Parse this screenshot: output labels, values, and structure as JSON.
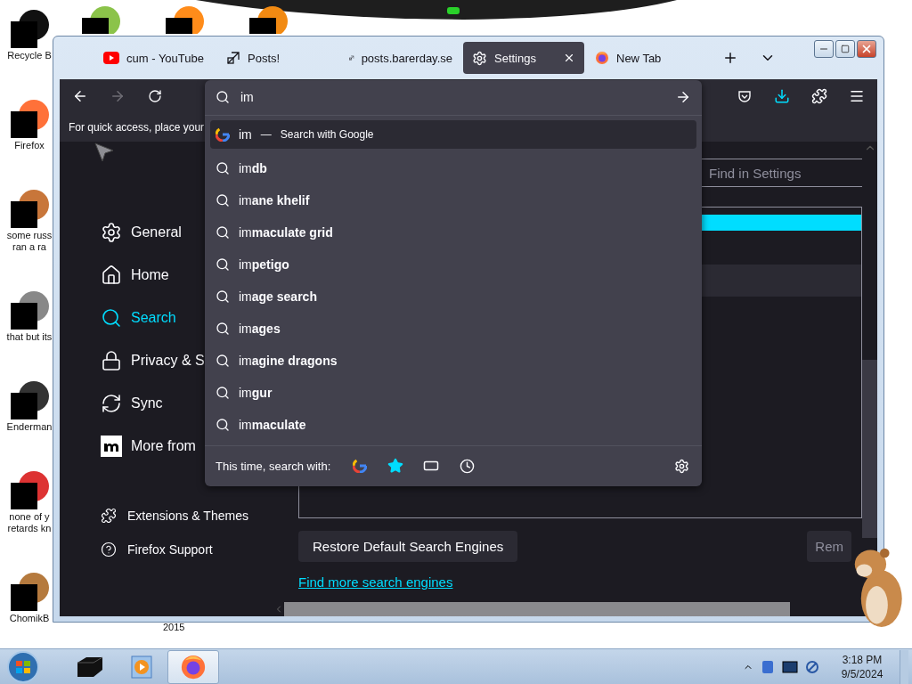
{
  "desktop_icons": [
    {
      "label": "Recycle B"
    },
    {
      "label": "Firefox"
    },
    {
      "label": "some russ ran a ra"
    },
    {
      "label": "that but its"
    },
    {
      "label": "Enderman"
    },
    {
      "label": "none of y retards kn"
    },
    {
      "label": "ChomikB"
    }
  ],
  "stray_label": "2015",
  "browser": {
    "tabs": [
      {
        "title": "cum - YouTube",
        "kind": "youtube",
        "selected": false
      },
      {
        "title": "Posts!",
        "kind": "shortcut",
        "selected": false
      },
      {
        "title": "posts.barerday.se",
        "kind": "shortcut",
        "selected": false
      },
      {
        "title": "Settings",
        "kind": "settings",
        "selected": true
      },
      {
        "title": "New Tab",
        "kind": "firefox",
        "selected": false
      }
    ],
    "bookmarks_hint": "For quick access, place your",
    "address_bar": {
      "value": "im"
    },
    "suggestions": [
      {
        "kind": "engine",
        "typed": "im",
        "dash": "—",
        "text": "Search with Google",
        "selected": true
      },
      {
        "kind": "query",
        "text": "im**db**",
        "selected": false
      },
      {
        "kind": "query",
        "text": "im**ane khelif**",
        "selected": false
      },
      {
        "kind": "query",
        "text": "im**maculate grid**",
        "selected": false
      },
      {
        "kind": "query",
        "text": "im**petigo**",
        "selected": false
      },
      {
        "kind": "query",
        "text": "im**age search**",
        "selected": false
      },
      {
        "kind": "query",
        "text": "im**ages**",
        "selected": false
      },
      {
        "kind": "query",
        "text": "im**agine dragons**",
        "selected": false
      },
      {
        "kind": "query",
        "text": "im**gur**",
        "selected": false
      },
      {
        "kind": "query",
        "text": "im**maculate**",
        "selected": false
      }
    ],
    "search_with": {
      "label": "This time, search with:",
      "engines": [
        {
          "kind": "google"
        },
        {
          "kind": "bookmarks"
        },
        {
          "kind": "tabs"
        },
        {
          "kind": "history"
        }
      ]
    },
    "sidebar": {
      "items": [
        {
          "label": "General",
          "kind": "gear",
          "selected": false
        },
        {
          "label": "Home",
          "kind": "home",
          "selected": false
        },
        {
          "label": "Search",
          "kind": "search",
          "selected": true
        },
        {
          "label": "Privacy & S",
          "kind": "lock",
          "selected": false
        },
        {
          "label": "Sync",
          "kind": "sync",
          "selected": false
        },
        {
          "label": "More from",
          "kind": "mozilla",
          "selected": false
        }
      ],
      "footer": [
        {
          "label": "Extensions & Themes",
          "kind": "puzzle"
        },
        {
          "label": "Firefox Support",
          "kind": "help"
        }
      ]
    },
    "settings": {
      "find_placeholder": "Find in Settings",
      "restore_button": "Restore Default Search Engines",
      "remove_button": "Rem",
      "more_link": "Find more search engines"
    }
  },
  "taskbar": {
    "items": [
      {
        "kind": "box",
        "active": false
      },
      {
        "kind": "player",
        "active": false
      },
      {
        "kind": "firefox",
        "active": true
      }
    ],
    "time": "3:18 PM",
    "date": "9/5/2024"
  }
}
